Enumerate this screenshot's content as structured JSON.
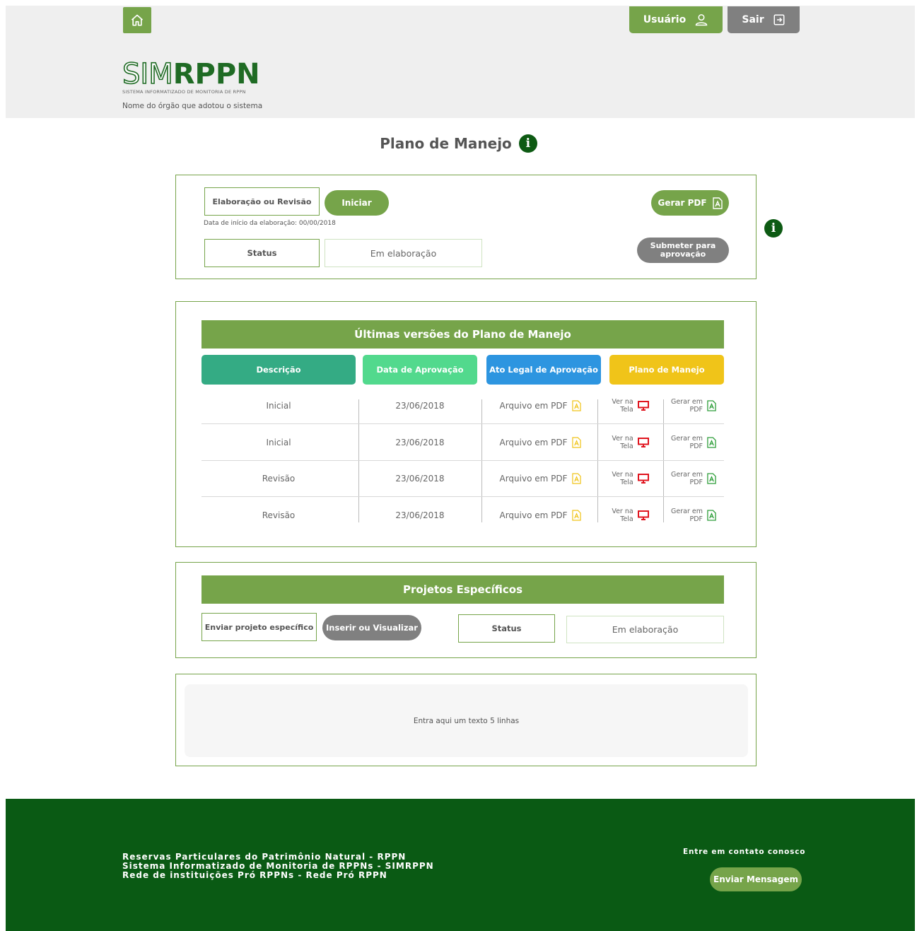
{
  "header": {
    "user_label": "Usuário",
    "exit_label": "Sair",
    "logo_part1": "SIM",
    "logo_part2": "RPPN",
    "logo_subtitle": "SISTEMA INFORMATIZADO DE MONITORIA DE RPPN",
    "org_name": "Nome do órgão que adotou o sistema"
  },
  "page": {
    "title": "Plano de Manejo"
  },
  "plan_panel": {
    "type_field": "Elaboração ou Revisão",
    "start_label": "Iniciar",
    "start_date_note": "Data de início da elaboração: 00/00/2018",
    "status_label": "Status",
    "status_value": "Em elaboração",
    "pdf_label": "Gerar PDF",
    "submit_label_1": "Submeter para",
    "submit_label_2": "aprovação"
  },
  "versions": {
    "title": "Últimas versões do Plano de Manejo",
    "columns": [
      "Descrição",
      "Data de Aprovação",
      "Ato Legal de Aprovação",
      "Plano de Manejo"
    ],
    "column_colors": [
      "#34ab84",
      "#52d98d",
      "#2d95e0",
      "#f0c419"
    ],
    "rows": [
      {
        "description": "Inicial",
        "date": "23/06/2018",
        "act": "Arquivo em PDF",
        "view_1": "Ver na",
        "view_2": "Tela",
        "gen_1": "Gerar em",
        "gen_2": "PDF"
      },
      {
        "description": "Inicial",
        "date": "23/06/2018",
        "act": "Arquivo em PDF",
        "view_1": "Ver na",
        "view_2": "Tela",
        "gen_1": "Gerar em",
        "gen_2": "PDF"
      },
      {
        "description": "Revisão",
        "date": "23/06/2018",
        "act": "Arquivo em PDF",
        "view_1": "Ver na",
        "view_2": "Tela",
        "gen_1": "Gerar em",
        "gen_2": "PDF"
      },
      {
        "description": "Revisão",
        "date": "23/06/2018",
        "act": "Arquivo em PDF",
        "view_1": "Ver na",
        "view_2": "Tela",
        "gen_1": "Gerar em",
        "gen_2": "PDF"
      }
    ]
  },
  "projects": {
    "title": "Projetos Específicos",
    "send_field": "Enviar projeto específico",
    "insert_label": "Inserir ou Visualizar",
    "status_label": "Status",
    "status_value": "Em elaboração"
  },
  "text_panel": {
    "text": "Entra aqui um texto 5 linhas"
  },
  "footer": {
    "line1": "Reservas Particulares do Patrimônio Natural - RPPN",
    "line2": "Sistema Informatizado de Monitoria de RPPNs - SIMRPPN",
    "line3": "Rede de instituições Pró RPPNs - Rede Pró RPPN",
    "contact": "Entre em contato conosco",
    "send_label": "Enviar Mensagem"
  },
  "colors": {
    "brand_green": "#76a44a",
    "dark_green": "#0a5a14",
    "gray_button": "#808080",
    "pdf_yellow": "#f0c419",
    "screen_red": "#e0141e",
    "pdf_green": "#2e9e3a"
  }
}
